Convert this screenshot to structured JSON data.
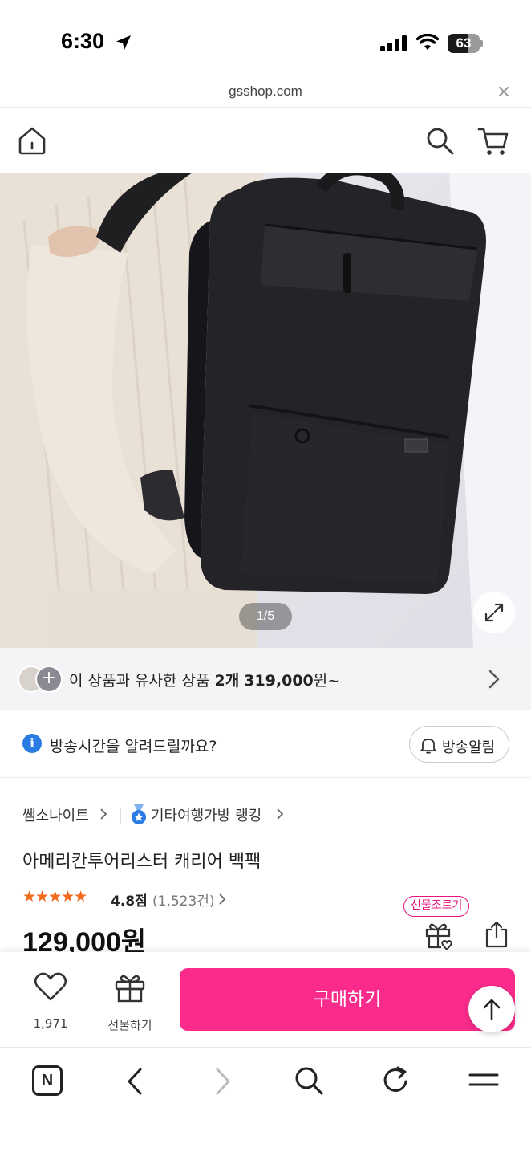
{
  "status_bar": {
    "time": "6:30",
    "battery": "63",
    "battery_level": 0.63
  },
  "browser": {
    "url": "gsshop.com"
  },
  "hero": {
    "page_counter": "1/5"
  },
  "similar": {
    "prefix": "이 상품과 유사한 상품 ",
    "count": "2개",
    "price": "319,000",
    "suffix": "원~"
  },
  "broadcast": {
    "message": "방송시간을 알려드릴까요?",
    "alarm_label": "방송알림"
  },
  "product": {
    "brand": "쌤소나이트",
    "ranking_label": "기타여행가방 랭킹",
    "title": "아메리칸투어리스터 캐리어 백팩",
    "stars": "★★★★★",
    "rating": 4.8,
    "rating_text": "4.8점",
    "review_count": "(1,523건)",
    "price": "129,000원",
    "gift_badge": "선물조르기"
  },
  "bottom_bar": {
    "like_count": "1,971",
    "gift_label": "선물하기",
    "buy_label": "구매하기"
  },
  "browser_nav": {
    "n_label": "N"
  },
  "colors": {
    "accent_pink": "#fb2b8c",
    "badge_pink": "#e8157f",
    "star_orange": "#f06a1a",
    "info_blue": "#2a7be4"
  },
  "icons": [
    "location-arrow-icon",
    "signal-icon",
    "wifi-icon",
    "battery-icon",
    "close-icon",
    "home-icon",
    "search-icon",
    "cart-icon",
    "expand-icon",
    "chevron-right-icon",
    "info-icon",
    "bell-icon",
    "medal-icon",
    "star-icon",
    "gift-icon",
    "share-icon",
    "heart-icon",
    "arrow-up-icon",
    "back-icon",
    "forward-icon",
    "refresh-icon",
    "menu-icon"
  ]
}
